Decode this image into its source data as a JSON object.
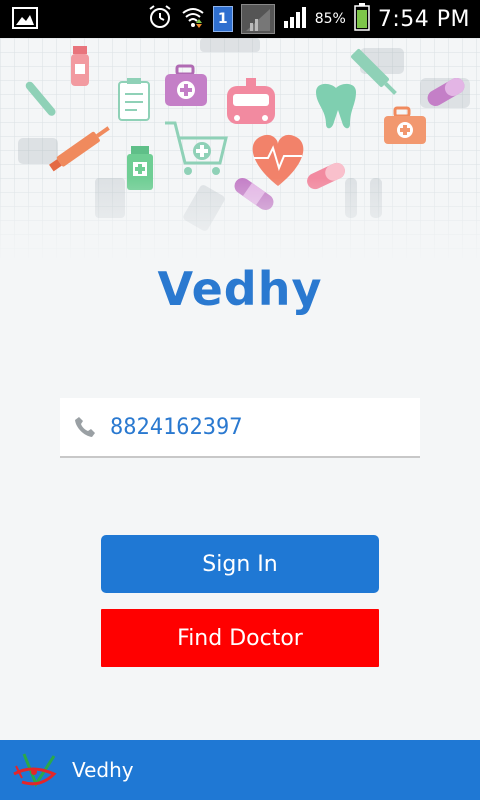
{
  "status_bar": {
    "battery_percent": "85%",
    "time": "7:54 PM",
    "notification_badge": "1"
  },
  "app": {
    "title": "Vedhy",
    "brand_color": "#2a79d0"
  },
  "login": {
    "phone_value": "8824162397",
    "phone_icon": "phone-icon"
  },
  "buttons": {
    "sign_in_label": "Sign In",
    "find_doctor_label": "Find Doctor",
    "sign_in_color": "#1f78d4",
    "find_doctor_color": "#ff0000"
  },
  "footer": {
    "label": "Vedhy",
    "color": "#1f78d4"
  }
}
